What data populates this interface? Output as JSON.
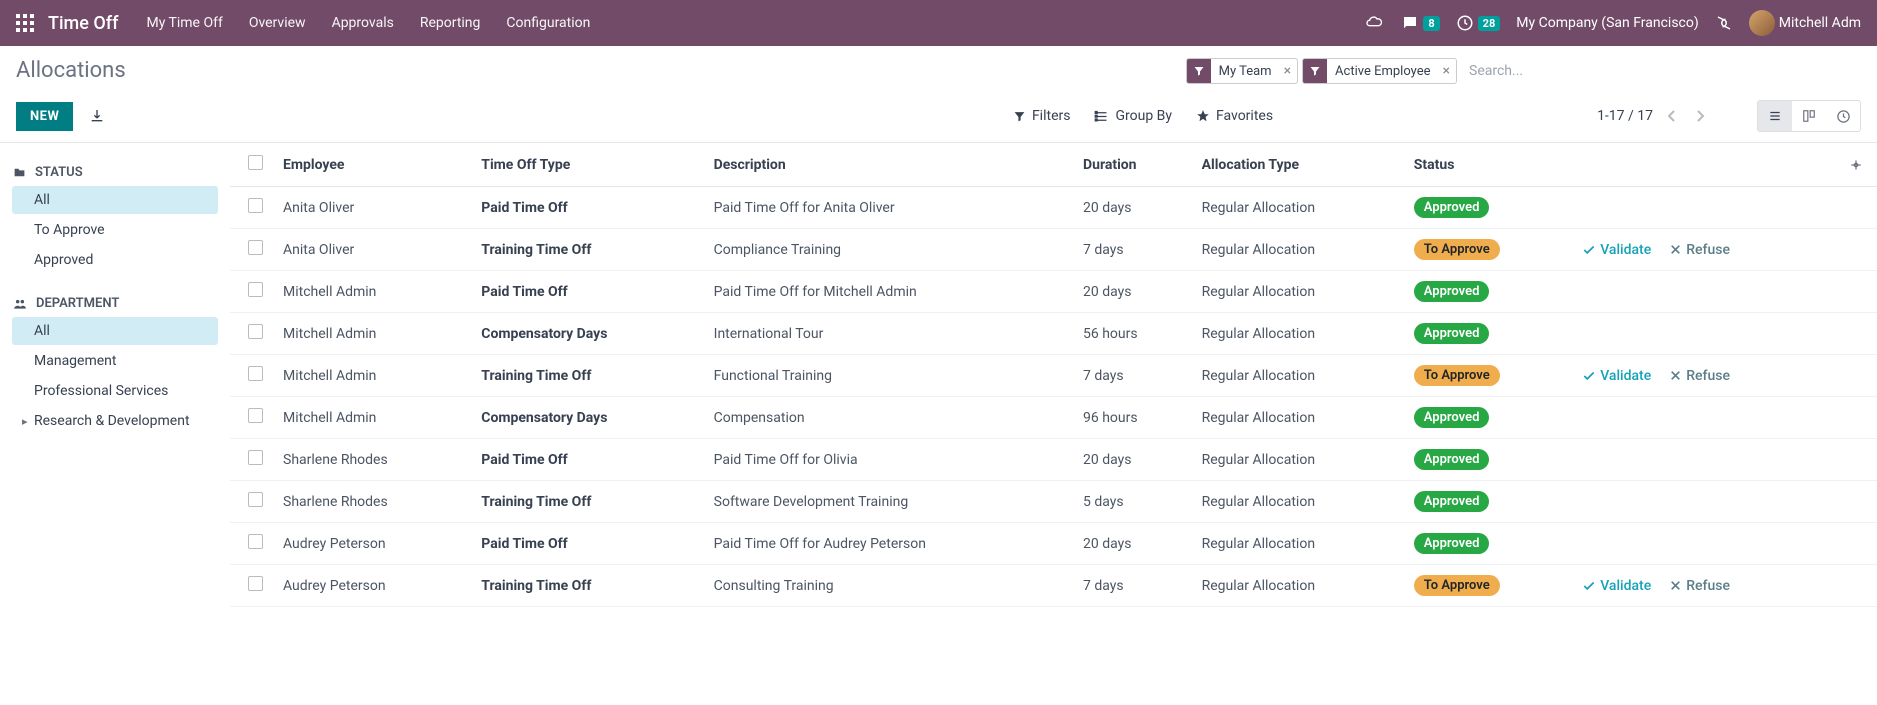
{
  "topbar": {
    "app_title": "Time Off",
    "nav": [
      "My Time Off",
      "Overview",
      "Approvals",
      "Reporting",
      "Configuration"
    ],
    "messages_count": "8",
    "activities_count": "28",
    "company": "My Company (San Francisco)",
    "user": "Mitchell Adm"
  },
  "breadcrumb": "Allocations",
  "search": {
    "facets": [
      {
        "label": "My Team"
      },
      {
        "label": "Active Employee"
      }
    ],
    "placeholder": "Search..."
  },
  "buttons": {
    "new": "NEW",
    "filters": "Filters",
    "groupby": "Group By",
    "favorites": "Favorites"
  },
  "pager": {
    "range": "1-17 / 17"
  },
  "sidebar": {
    "status_title": "STATUS",
    "status_items": [
      {
        "label": "All",
        "active": true
      },
      {
        "label": "To Approve",
        "active": false
      },
      {
        "label": "Approved",
        "active": false
      }
    ],
    "dept_title": "DEPARTMENT",
    "dept_items": [
      {
        "label": "All",
        "active": true,
        "caret": false
      },
      {
        "label": "Management",
        "active": false,
        "caret": false
      },
      {
        "label": "Professional Services",
        "active": false,
        "caret": false
      },
      {
        "label": "Research & Development",
        "active": false,
        "caret": true
      }
    ]
  },
  "table": {
    "headers": {
      "employee": "Employee",
      "type": "Time Off Type",
      "description": "Description",
      "duration": "Duration",
      "alloc_type": "Allocation Type",
      "status": "Status"
    },
    "action_labels": {
      "validate": "Validate",
      "refuse": "Refuse"
    },
    "rows": [
      {
        "employee": "Anita Oliver",
        "type": "Paid Time Off",
        "description": "Paid Time Off for Anita Oliver",
        "duration": "20 days",
        "alloc_type": "Regular Allocation",
        "status": "Approved",
        "status_class": "approved",
        "actions": false
      },
      {
        "employee": "Anita Oliver",
        "type": "Training Time Off",
        "description": "Compliance Training",
        "duration": "7 days",
        "alloc_type": "Regular Allocation",
        "status": "To Approve",
        "status_class": "toapprove",
        "actions": true
      },
      {
        "employee": "Mitchell Admin",
        "type": "Paid Time Off",
        "description": "Paid Time Off for Mitchell Admin",
        "duration": "20 days",
        "alloc_type": "Regular Allocation",
        "status": "Approved",
        "status_class": "approved",
        "actions": false
      },
      {
        "employee": "Mitchell Admin",
        "type": "Compensatory Days",
        "description": "International Tour",
        "duration": "56 hours",
        "alloc_type": "Regular Allocation",
        "status": "Approved",
        "status_class": "approved",
        "actions": false
      },
      {
        "employee": "Mitchell Admin",
        "type": "Training Time Off",
        "description": "Functional Training",
        "duration": "7 days",
        "alloc_type": "Regular Allocation",
        "status": "To Approve",
        "status_class": "toapprove",
        "actions": true
      },
      {
        "employee": "Mitchell Admin",
        "type": "Compensatory Days",
        "description": "Compensation",
        "duration": "96 hours",
        "alloc_type": "Regular Allocation",
        "status": "Approved",
        "status_class": "approved",
        "actions": false
      },
      {
        "employee": "Sharlene Rhodes",
        "type": "Paid Time Off",
        "description": "Paid Time Off for Olivia",
        "duration": "20 days",
        "alloc_type": "Regular Allocation",
        "status": "Approved",
        "status_class": "approved",
        "actions": false
      },
      {
        "employee": "Sharlene Rhodes",
        "type": "Training Time Off",
        "description": "Software Development Training",
        "duration": "5 days",
        "alloc_type": "Regular Allocation",
        "status": "Approved",
        "status_class": "approved",
        "actions": false
      },
      {
        "employee": "Audrey Peterson",
        "type": "Paid Time Off",
        "description": "Paid Time Off for Audrey Peterson",
        "duration": "20 days",
        "alloc_type": "Regular Allocation",
        "status": "Approved",
        "status_class": "approved",
        "actions": false
      },
      {
        "employee": "Audrey Peterson",
        "type": "Training Time Off",
        "description": "Consulting Training",
        "duration": "7 days",
        "alloc_type": "Regular Allocation",
        "status": "To Approve",
        "status_class": "toapprove",
        "actions": true
      }
    ]
  }
}
